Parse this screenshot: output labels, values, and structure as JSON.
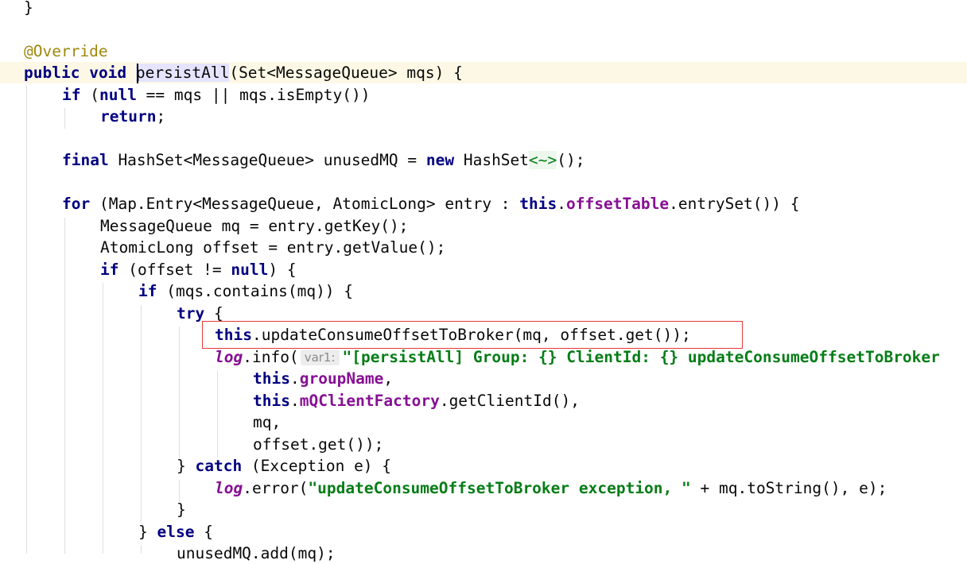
{
  "editor": {
    "language": "Java",
    "highlighted_call": "this.updateConsumeOffsetToBroker(mq, offset.get());",
    "lines": {
      "l0": "}",
      "l2_annotation": "@Override",
      "l3": {
        "public": "public",
        "void": "void",
        "method": "persistAll",
        "params": "(Set<MessageQueue> mqs) {"
      },
      "l4": {
        "if": "if",
        "open": " (",
        "null": "null",
        "rest": " == mqs || mqs.isEmpty())"
      },
      "l5": {
        "return": "return",
        "semi": ";"
      },
      "l7": {
        "final": "final",
        "type": " HashSet<MessageQueue> unusedMQ = ",
        "new": "new",
        "cls": " HashSet",
        "diamond": "<~>",
        "end": "();"
      },
      "l9": {
        "for": "for",
        "mid": " (Map.Entry<MessageQueue, AtomicLong> entry : ",
        "this": "this",
        "dot": ".",
        "field": "offsetTable",
        "end": ".entrySet()) {"
      },
      "l10": "MessageQueue mq = entry.getKey();",
      "l11": "AtomicLong offset = entry.getValue();",
      "l12": {
        "if": "if",
        "mid": " (offset != ",
        "null": "null",
        "end": ") {"
      },
      "l13": {
        "if": "if",
        "end": " (mqs.contains(mq)) {"
      },
      "l14": {
        "try": "try",
        "end": " {"
      },
      "l15": {
        "this": "this",
        "end": ".updateConsumeOffsetToBroker(mq, offset.get());"
      },
      "l16": {
        "log": "log",
        "mid": ".info(",
        "hint": "var1:",
        "str": "\"[persistAll] Group: {} ClientId: {} updateConsumeOffsetToBroker"
      },
      "l17": {
        "this": "this",
        "dot": ".",
        "field": "groupName",
        "end": ","
      },
      "l18": {
        "this": "this",
        "dot": ".",
        "field": "mQClientFactory",
        "end": ".getClientId(),"
      },
      "l19": "mq,",
      "l20": "offset.get());",
      "l21": {
        "close": "} ",
        "catch": "catch",
        "end": " (Exception e) {"
      },
      "l22": {
        "log": "log",
        "mid": ".error(",
        "str": "\"updateConsumeOffsetToBroker exception, \"",
        "end": " + mq.toString(), e);"
      },
      "l23": "}",
      "l24": {
        "close": "} ",
        "else": "else",
        "end": " {"
      },
      "l25": "unusedMQ.add(mq);"
    }
  },
  "colors": {
    "keyword": "#0033b3",
    "annotation": "#9e880d",
    "field": "#871094",
    "string": "#067d17",
    "current_line": "#fdf8e6",
    "highlight_box": "#e53935"
  }
}
